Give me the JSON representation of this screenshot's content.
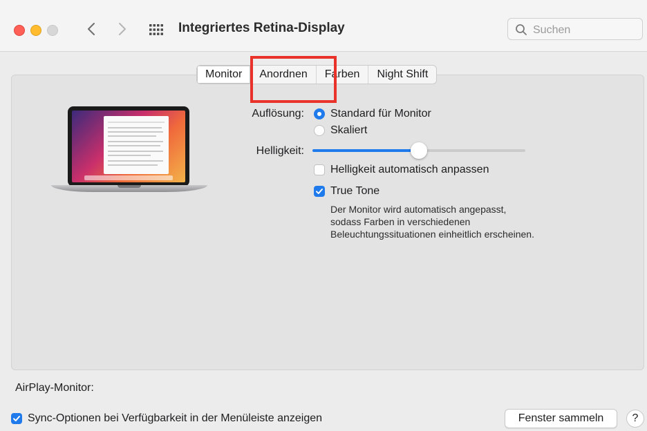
{
  "window": {
    "title": "Integriertes Retina-Display",
    "search_placeholder": "Suchen"
  },
  "tabs": [
    {
      "label": "Monitor",
      "active": true
    },
    {
      "label": "Anordnen",
      "active": false
    },
    {
      "label": "Farben",
      "active": false
    },
    {
      "label": "Night Shift",
      "active": false
    }
  ],
  "display": {
    "resolution_label": "Auflösung:",
    "resolution_options": [
      {
        "label": "Standard für Monitor",
        "selected": true
      },
      {
        "label": "Skaliert",
        "selected": false
      }
    ],
    "brightness_label": "Helligkeit:",
    "brightness_level": 0.5,
    "auto_brightness_label": "Helligkeit automatisch anpassen",
    "auto_brightness_checked": false,
    "true_tone_label": "True Tone",
    "true_tone_checked": true,
    "true_tone_description": "Der Monitor wird automatisch angepasst, sodass Farben in verschiedenen Beleuchtungssituationen einheitlich erscheinen."
  },
  "footer": {
    "airplay_label": "AirPlay-Monitor:",
    "sync_label": "Sync-Optionen bei Verfügbarkeit in der Menüleiste anzeigen",
    "sync_checked": true,
    "gather_windows_button": "Fenster sammeln",
    "help_button": "?"
  },
  "colors": {
    "accent": "#1f7aec",
    "annotation_box": "#e8322a"
  }
}
